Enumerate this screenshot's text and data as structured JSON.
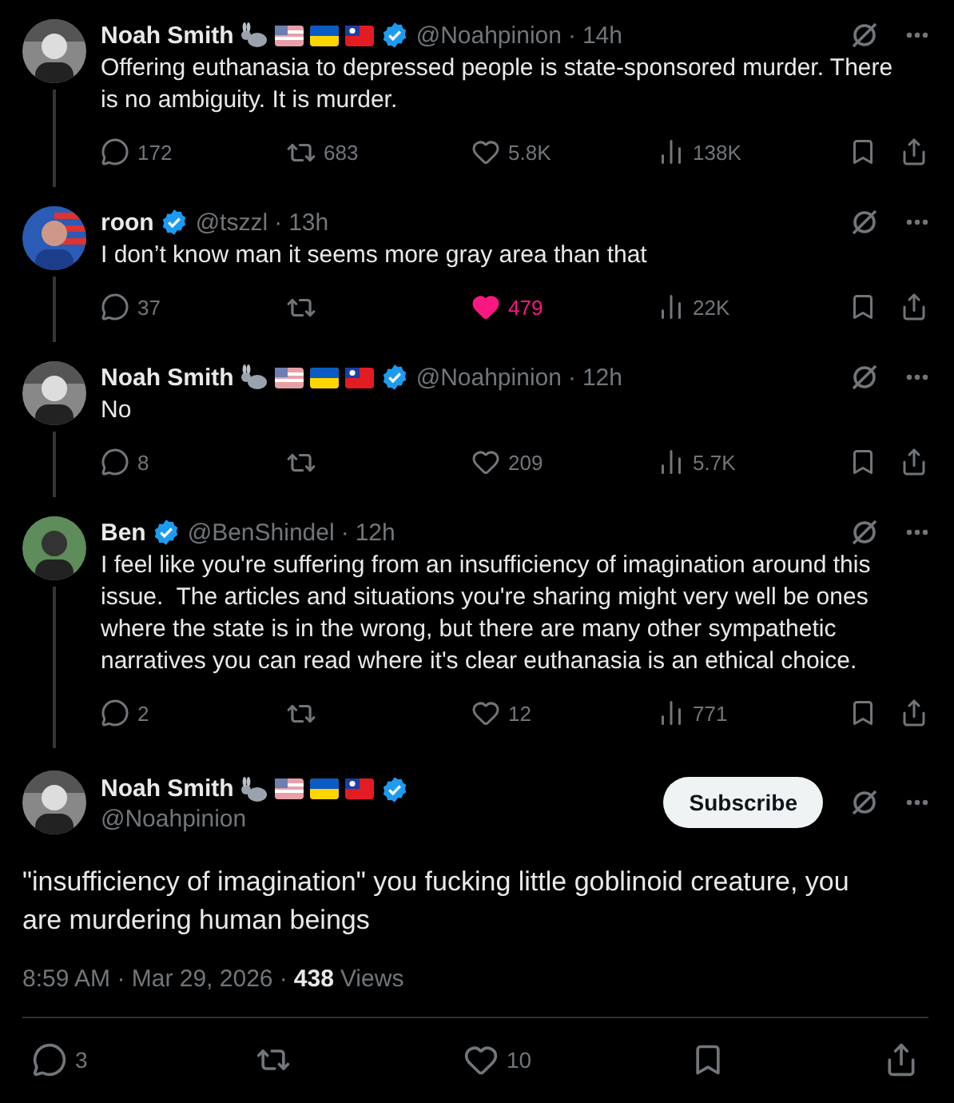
{
  "thread": [
    {
      "name": "Noah Smith",
      "name_emoji": true,
      "verified": true,
      "handle": "@Noahpinion",
      "separator": "·",
      "time": "14h",
      "text": "Offering euthanasia to depressed people is state-sponsored murder. There is no ambiguity. It is murder.",
      "replies": "172",
      "reposts": "683",
      "likes": "5.8K",
      "liked": false,
      "views": "138K"
    },
    {
      "name": "roon",
      "name_emoji": false,
      "verified": true,
      "handle": "@tszzl",
      "separator": "·",
      "time": "13h",
      "text": "I don’t know man it seems more gray area than that",
      "replies": "37",
      "likes": "479",
      "liked": true,
      "views": "22K"
    },
    {
      "name": "Noah Smith",
      "name_emoji": true,
      "verified": true,
      "handle": "@Noahpinion",
      "separator": "·",
      "time": "12h",
      "text": "No",
      "replies": "8",
      "likes": "209",
      "liked": false,
      "views": "5.7K"
    },
    {
      "name": "Ben",
      "name_emoji": false,
      "verified": true,
      "handle": "@BenShindel",
      "separator": "·",
      "time": "12h",
      "text": "I feel like you're suffering from an insufficiency of imagination around this issue.  The articles and situations you're sharing might very well be ones where the state is in the wrong, but there are many other sympathetic narratives you can read where it's clear euthanasia is an ethical choice.",
      "replies": "2",
      "likes": "12",
      "liked": false,
      "views": "771"
    }
  ],
  "main": {
    "name": "Noah Smith",
    "name_emoji": true,
    "verified": true,
    "handle": "@Noahpinion",
    "subscribe": "Subscribe",
    "text": "\"insufficiency of imagination\" you fucking little goblinoid creature, you are murdering human beings",
    "timestamp": "8:59 AM · Mar 29, 2026 · ",
    "views_count": "438",
    "views_label": "Views",
    "replies": "3",
    "likes": "10",
    "liked": false
  }
}
